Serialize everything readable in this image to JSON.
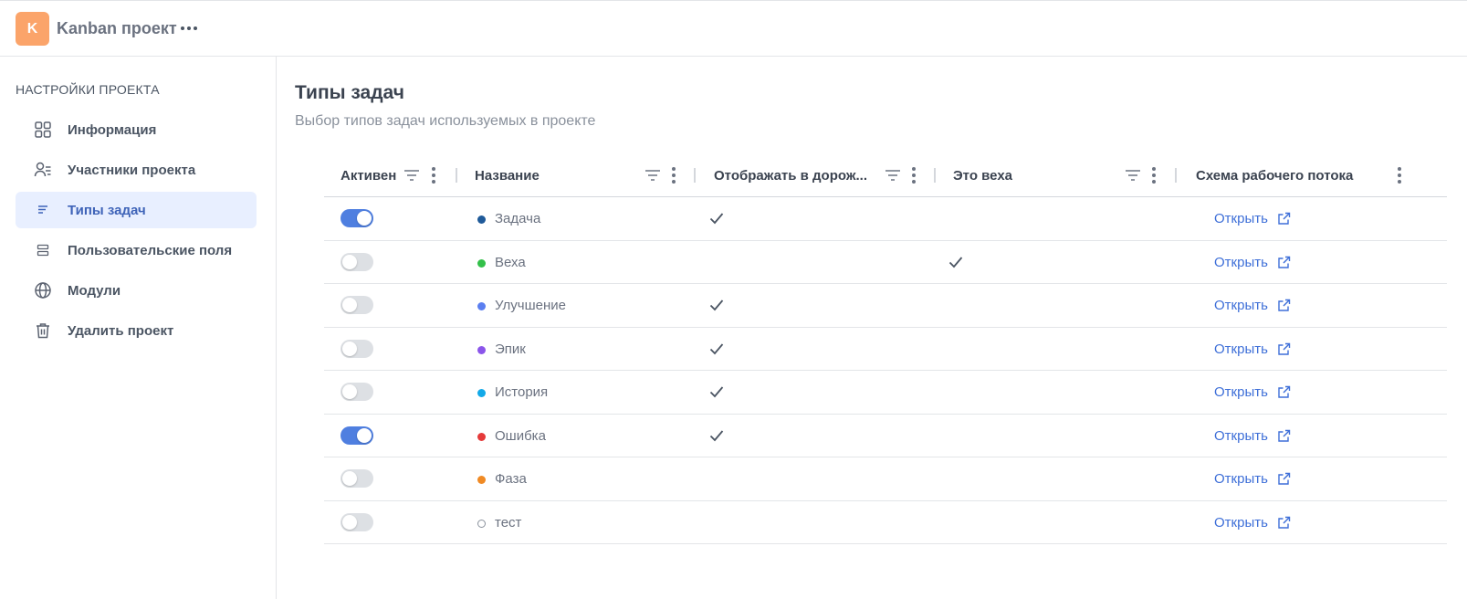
{
  "header": {
    "avatar_letter": "K",
    "avatar_color": "#fba46a",
    "project_name": "Kanban проект",
    "more_icon": "more-horizontal-icon"
  },
  "sidebar": {
    "title": "НАСТРОЙКИ ПРОЕКТА",
    "items": [
      {
        "label": "Информация",
        "icon": "grid-icon",
        "active": false
      },
      {
        "label": "Участники проекта",
        "icon": "users-icon",
        "active": false
      },
      {
        "label": "Типы задач",
        "icon": "list-icon",
        "active": true
      },
      {
        "label": "Пользовательские поля",
        "icon": "fields-icon",
        "active": false
      },
      {
        "label": "Модули",
        "icon": "globe-icon",
        "active": false
      },
      {
        "label": "Удалить проект",
        "icon": "trash-icon",
        "active": false
      }
    ]
  },
  "main": {
    "title": "Типы задач",
    "subtitle": "Выбор типов задач используемых в проекте"
  },
  "table": {
    "columns": [
      {
        "label": "Активен"
      },
      {
        "label": "Название"
      },
      {
        "label": "Отображать в дорож..."
      },
      {
        "label": "Это веха"
      },
      {
        "label": "Схема рабочего потока"
      }
    ],
    "open_label": "Открыть",
    "rows": [
      {
        "active": true,
        "name": "Задача",
        "color": "#1f5a99",
        "roadmap": true,
        "milestone": false
      },
      {
        "active": false,
        "name": "Веха",
        "color": "#33c04a",
        "roadmap": false,
        "milestone": true
      },
      {
        "active": false,
        "name": "Улучшение",
        "color": "#5b7ff0",
        "roadmap": true,
        "milestone": false
      },
      {
        "active": false,
        "name": "Эпик",
        "color": "#8b55ea",
        "roadmap": true,
        "milestone": false
      },
      {
        "active": false,
        "name": "История",
        "color": "#13a9e8",
        "roadmap": true,
        "milestone": false
      },
      {
        "active": true,
        "name": "Ошибка",
        "color": "#e53a3a",
        "roadmap": true,
        "milestone": false
      },
      {
        "active": false,
        "name": "Фаза",
        "color": "#f08a24",
        "roadmap": false,
        "milestone": false
      },
      {
        "active": false,
        "name": "тест",
        "color": "",
        "roadmap": false,
        "milestone": false
      }
    ]
  }
}
